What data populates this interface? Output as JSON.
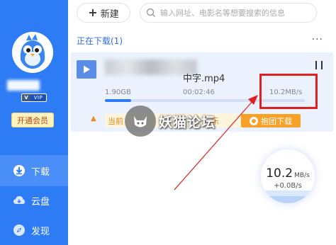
{
  "sidebar": {
    "vip_badge": "VIP",
    "vip_letter": "V",
    "open_vip": "开通会员",
    "nav": [
      {
        "label": "下载",
        "icon": "download-icon"
      },
      {
        "label": "云盘",
        "icon": "cloud-icon"
      },
      {
        "label": "发现",
        "icon": "compass-icon"
      }
    ]
  },
  "topbar": {
    "new_label": "新建",
    "new_plus": "+",
    "search_placeholder": "输入网址、电影名等想要搜索的信息"
  },
  "downloads": {
    "section_title": "正在下载(1)",
    "more": "···",
    "task": {
      "file_name_visible": "中字.mp4",
      "size": "1.90GB",
      "elapsed": "00:02:46",
      "speed": "10.2MB/s",
      "progress_fraction": 0.13
    },
    "promo": {
      "text_start": "当前",
      "text_end": "乐",
      "button": "抱团下载"
    }
  },
  "watermark": {
    "text": "妖猫论坛"
  },
  "speed_gauge": {
    "value": "10.2",
    "unit": "MB/s",
    "upload": "+0.0B/s"
  },
  "colors": {
    "sidebar_bg": "#2d7bf5",
    "accent": "#2d7bf5",
    "annotation_red": "#e01f1f",
    "promo_orange": "#f7a128"
  }
}
